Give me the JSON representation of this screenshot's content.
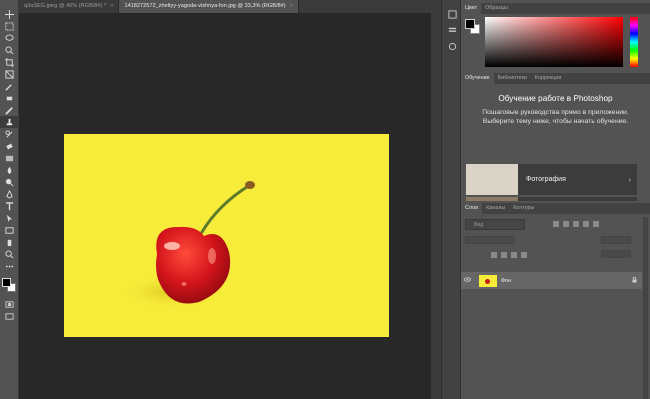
{
  "tabs": [
    {
      "label": "q3aSEG.jpeg @ 40% (RGB/8#) *",
      "close": "×",
      "active": false
    },
    {
      "label": "1418272572_zheltyy-yagoda-vishnya-fon.jpg @ 33,3% (RGB/8#)",
      "close": "×",
      "active": true
    }
  ],
  "toolbar": {
    "tools": [
      "move-icon",
      "marquee-icon",
      "lasso-icon",
      "quick-select-icon",
      "crop-icon",
      "frame-icon",
      "eyedropper-icon",
      "healing-icon",
      "brush-icon",
      "clone-stamp-icon",
      "history-brush-icon",
      "eraser-icon",
      "gradient-icon",
      "blur-icon",
      "dodge-icon",
      "pen-icon",
      "type-icon",
      "path-select-icon",
      "rectangle-icon",
      "hand-icon",
      "zoom-icon",
      "more-icon"
    ],
    "active_tool": "clone-stamp-icon"
  },
  "color_panel": {
    "tabs": [
      "Цвет",
      "Образцы"
    ],
    "foreground": "#000000",
    "background": "#ffffff"
  },
  "learn_panel": {
    "tabs": [
      "Обучение",
      "Библиотеки",
      "Коррекция"
    ],
    "title": "Обучение работе в Photoshop",
    "description": "Пошаговые руководства прямо в приложении. Выберите тему ниже, чтобы начать обучение.",
    "cards": [
      {
        "label": "Фотография",
        "chevron": "›"
      }
    ]
  },
  "layers_panel": {
    "tabs": [
      "Слои",
      "Каналы",
      "Контуры"
    ],
    "search_placeholder": "Вид",
    "layer": {
      "name": "Фон",
      "visible": true,
      "locked": true
    }
  },
  "photo": {
    "background": "#f8ec3a",
    "subject": "red cherry"
  }
}
